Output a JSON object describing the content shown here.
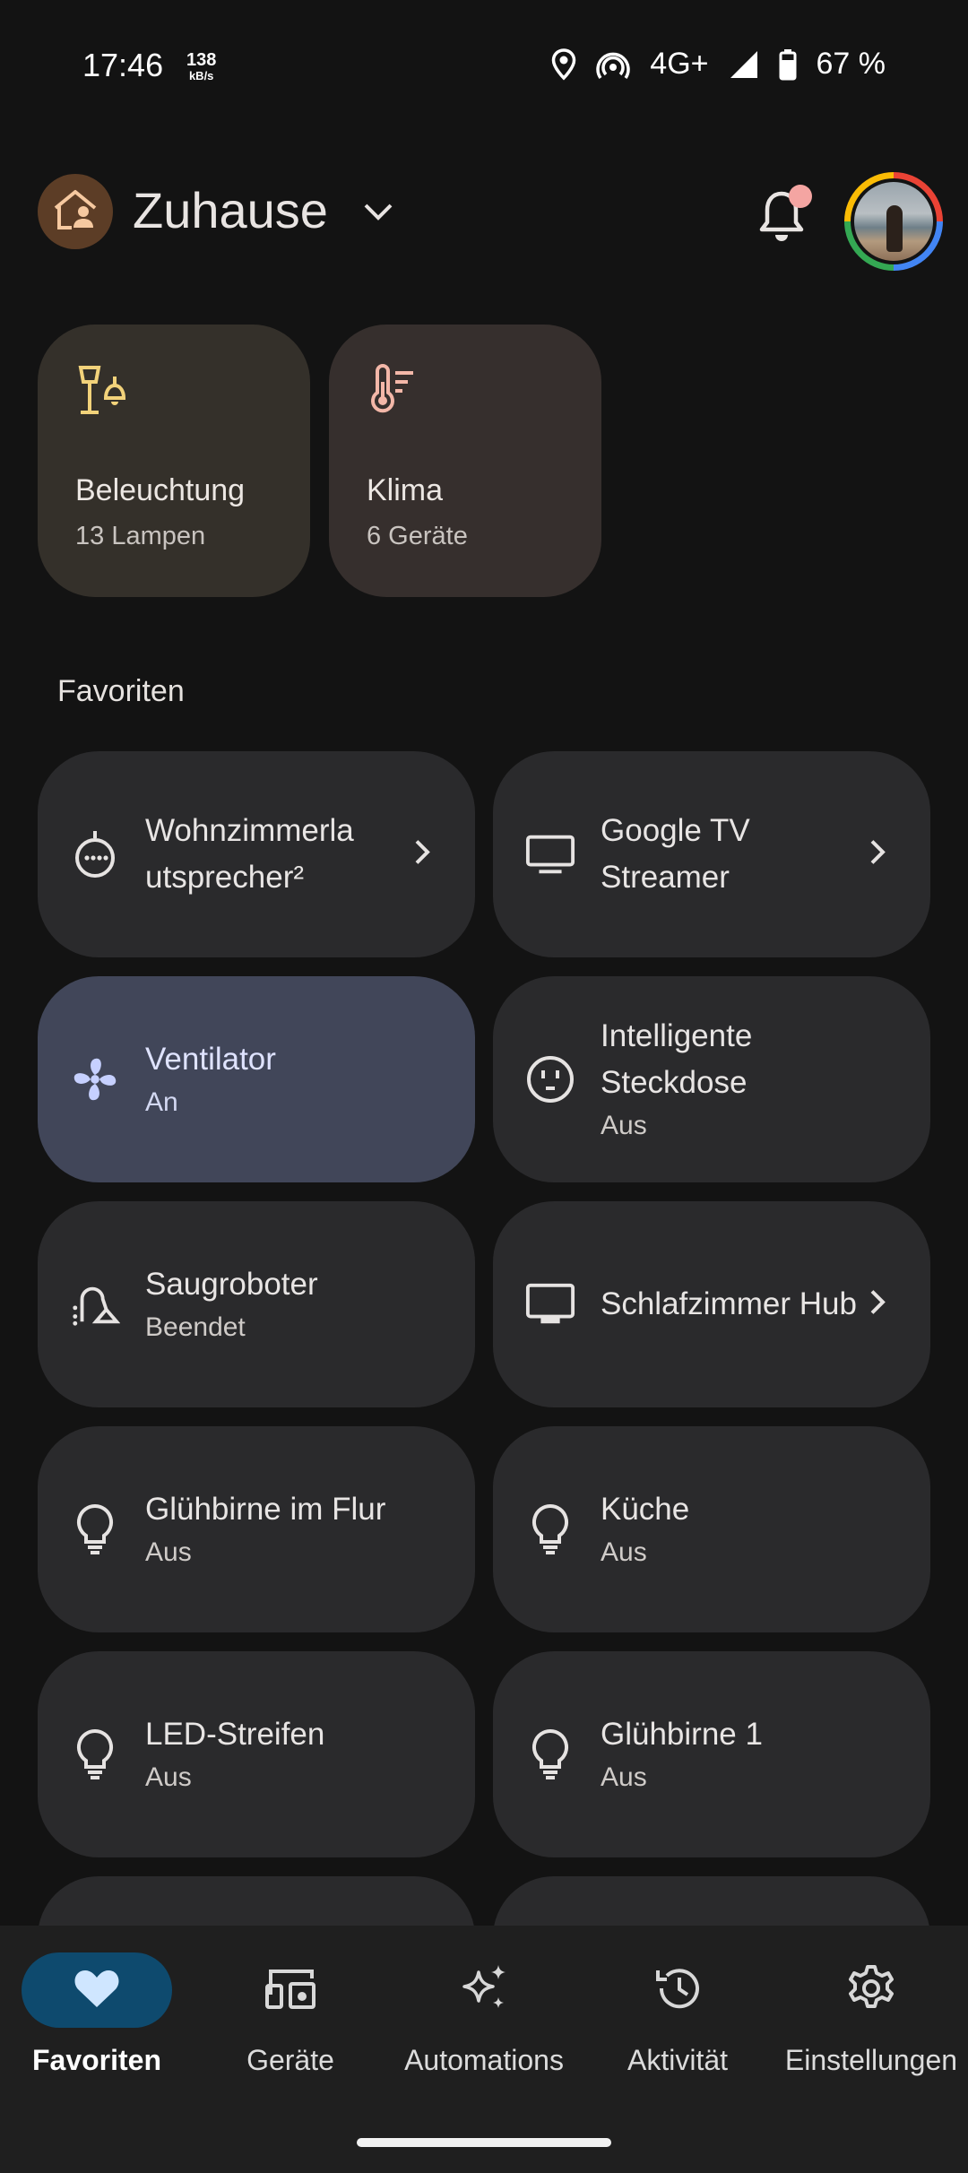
{
  "status_bar": {
    "time": "17:46",
    "speed_value": "138",
    "speed_unit": "kB/s",
    "network": "4G+",
    "battery": "67 %",
    "icons": [
      "location-icon",
      "hotspot-icon",
      "signal-icon",
      "battery-icon"
    ]
  },
  "header": {
    "home_name": "Zuhause",
    "notification_dot_color": "#f4a5a2"
  },
  "categories": [
    {
      "title": "Beleuchtung",
      "subtitle": "13 Lampen",
      "icon": "lamp-icon"
    },
    {
      "title": "Klima",
      "subtitle": "6 Geräte",
      "icon": "thermometer-icon"
    }
  ],
  "favorites": {
    "title": "Favoriten",
    "tiles": [
      {
        "name": "Wohnzimmerla utsprecher²",
        "status": "",
        "icon": "speaker-icon",
        "chevron": true,
        "active": false
      },
      {
        "name": "Google TV Streamer",
        "status": "",
        "icon": "tv-icon",
        "chevron": true,
        "active": false
      },
      {
        "name": "Ventilator",
        "status": "An",
        "icon": "fan-icon",
        "chevron": false,
        "active": true
      },
      {
        "name": "Intelligente Steckdose",
        "status": "Aus",
        "icon": "outlet-icon",
        "chevron": false,
        "active": false
      },
      {
        "name": "Saugroboter",
        "status": "Beendet",
        "icon": "vacuum-icon",
        "chevron": false,
        "active": false
      },
      {
        "name": "Schlafzimmer Hub",
        "status": "",
        "icon": "display-icon",
        "chevron": true,
        "active": false
      },
      {
        "name": "Glühbirne im Flur",
        "status": "Aus",
        "icon": "bulb-icon",
        "chevron": false,
        "active": false
      },
      {
        "name": "Küche",
        "status": "Aus",
        "icon": "bulb-icon",
        "chevron": false,
        "active": false
      },
      {
        "name": "LED-Streifen",
        "status": "Aus",
        "icon": "bulb-icon",
        "chevron": false,
        "active": false
      },
      {
        "name": "Glühbirne 1",
        "status": "Aus",
        "icon": "bulb-icon",
        "chevron": false,
        "active": false
      }
    ]
  },
  "bottom_nav": [
    {
      "label": "Favoriten",
      "icon": "heart-icon",
      "active": true
    },
    {
      "label": "Geräte",
      "icon": "devices-icon",
      "active": false
    },
    {
      "label": "Automations",
      "icon": "sparkle-icon",
      "active": false
    },
    {
      "label": "Aktivität",
      "icon": "history-icon",
      "active": false
    },
    {
      "label": "Einstellungen",
      "icon": "gear-icon",
      "active": false
    }
  ],
  "colors": {
    "background": "#131313",
    "tile": "#2a2a2c",
    "tile_active": "#414659",
    "nav_active": "#0e4a6e",
    "lighting_card": "#34302a",
    "climate_card": "#362f2d",
    "lighting_icon": "#f2d27a",
    "climate_icon": "#f3b7a8"
  }
}
